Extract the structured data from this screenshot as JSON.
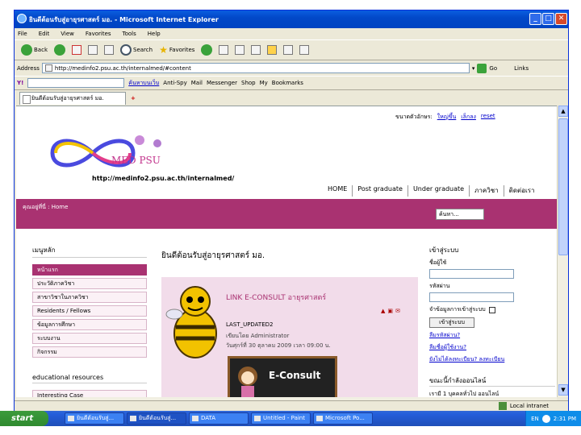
{
  "window": {
    "title": "ยินดีต้อนรับสู่อายุรศาสตร์ มอ. - Microsoft Internet Explorer",
    "controls": [
      "_",
      "□",
      "✕"
    ]
  },
  "menu": [
    "File",
    "Edit",
    "View",
    "Favorites",
    "Tools",
    "Help"
  ],
  "toolbar": {
    "back": "Back",
    "search": "Search",
    "favorites": "Favorites"
  },
  "address": {
    "label": "Address",
    "url": "http://medinfo2.psu.ac.th/internalmed/#content",
    "go": "Go",
    "links": "Links"
  },
  "yahoo_bar": {
    "yahoo": "Y!",
    "search_btn": "ค้นหาบนเว็บ",
    "items": [
      "Anti-Spy",
      "Mail",
      "Messenger",
      "Shop",
      "My",
      "Bookmarks"
    ]
  },
  "tabs": {
    "active": "ยินดีต้อนรับสู่อายุรศาสตร์ มอ.",
    "new_tab": "+"
  },
  "page": {
    "top_links": [
      "ขนาดตัวอักษร:",
      "ใหญ่ขึ้น",
      "เล็กลง",
      "reset"
    ],
    "logo_text": "MED PSU",
    "site_url": "http://medinfo2.psu.ac.th/internalmed/",
    "nav": [
      "HOME",
      "Post graduate",
      "Under graduate",
      "ภาควิชา",
      "ติดต่อเรา"
    ],
    "breadcrumb_label": "คุณอยู่ที่นี่ :",
    "breadcrumb_value": "Home",
    "search_value": "ค้นหา...",
    "main_menu_title": "เมนูหลัก",
    "menu_items": [
      "หน้าแรก",
      "ประวัติภาควิชา",
      "สาขาวิชาในภาควิชา",
      "Residents / Fellows",
      "ข้อมูลการศึกษา",
      "ระบบงาน",
      "กิจกรรม"
    ],
    "edu_title": "educational resources",
    "edu_first": "Interesting Case",
    "welcome_title": "ยินดีต้อนรับสู่อายุรศาสตร์ มอ.",
    "article_title": "LINK E-CONSULT อายุรศาสตร์",
    "last_updated": "LAST_UPDATED2",
    "author": "เขียนโดย Administrator",
    "date": "วันศุกร์ที่ 30 ตุลาคม 2009 เวลา 09:00 น.",
    "econsult_label": "E-Consult",
    "login_title": "เข้าสู่ระบบ",
    "username_label": "ชื่อผู้ใช้",
    "password_label": "รหัสผ่าน",
    "remember_label": "จำข้อมูลการเข้าสู่ระบบ",
    "login_button": "เข้าสู่ระบบ",
    "forgot_password": "ลืมรหัสผ่าน?",
    "forgot_username": "ลืมชื่อผู้ใช้งาน?",
    "register": "ยังไม่ได้ลงทะเบียน? ลงทะเบียน",
    "online_title": "ขณะนี้กำลังออนไลน์",
    "online_text": "เรามี 1 บุคคลทั่วไป ออนไลน์"
  },
  "status": {
    "zone": "Local intranet"
  },
  "taskbar": {
    "start": "start",
    "tasks": [
      "ยินดีต้อนรับสู่...",
      "ยินดีต้อนรับสู่...",
      "DATA",
      "Untitled - Paint",
      "Microsoft Po..."
    ],
    "lang": "EN",
    "clock": "2:31 PM"
  },
  "colors": {
    "accent": "#a93271",
    "titlebar": "#0a5ee0",
    "taskbar": "#245edb",
    "start": "#3c9b3c"
  }
}
